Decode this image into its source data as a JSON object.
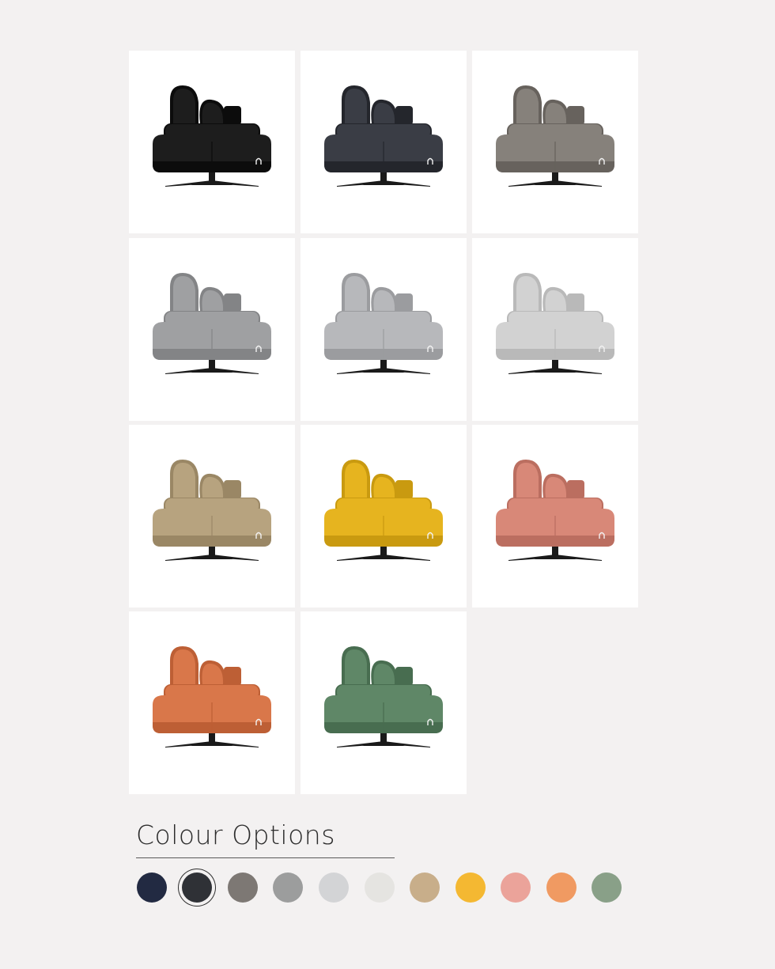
{
  "heading": "Colour Options",
  "selected_index": 1,
  "swatches": [
    {
      "name": "navy-swatch",
      "color": "#222a42"
    },
    {
      "name": "charcoal-swatch",
      "color": "#2f3136"
    },
    {
      "name": "taupe-grey-swatch",
      "color": "#7d7874"
    },
    {
      "name": "mid-grey-swatch",
      "color": "#9c9d9d"
    },
    {
      "name": "light-grey-swatch",
      "color": "#d3d4d6"
    },
    {
      "name": "off-white-swatch",
      "color": "#e5e4e1"
    },
    {
      "name": "sand-swatch",
      "color": "#c8ae8a"
    },
    {
      "name": "yellow-swatch",
      "color": "#f4b832"
    },
    {
      "name": "blush-pink-swatch",
      "color": "#eba39a"
    },
    {
      "name": "orange-swatch",
      "color": "#f09a62"
    },
    {
      "name": "sage-green-swatch",
      "color": "#89a088"
    }
  ],
  "products": [
    {
      "name": "sofa-black",
      "color": "#1d1d1d",
      "shade": "#0c0c0c"
    },
    {
      "name": "sofa-charcoal",
      "color": "#3a3d45",
      "shade": "#24262c"
    },
    {
      "name": "sofa-taupe",
      "color": "#86817b",
      "shade": "#67625d"
    },
    {
      "name": "sofa-mid-grey",
      "color": "#9fa0a2",
      "shade": "#838486"
    },
    {
      "name": "sofa-light-grey",
      "color": "#b7b8bb",
      "shade": "#9b9c9f"
    },
    {
      "name": "sofa-off-white",
      "color": "#d2d2d2",
      "shade": "#b9b9b9"
    },
    {
      "name": "sofa-sand",
      "color": "#b7a37f",
      "shade": "#9a8765"
    },
    {
      "name": "sofa-yellow",
      "color": "#e6b41f",
      "shade": "#c99a10"
    },
    {
      "name": "sofa-blush-pink",
      "color": "#d88878",
      "shade": "#bb6e60"
    },
    {
      "name": "sofa-orange",
      "color": "#d9774a",
      "shade": "#bd5f35"
    },
    {
      "name": "sofa-sage-green",
      "color": "#5f8767",
      "shade": "#486d50"
    }
  ]
}
